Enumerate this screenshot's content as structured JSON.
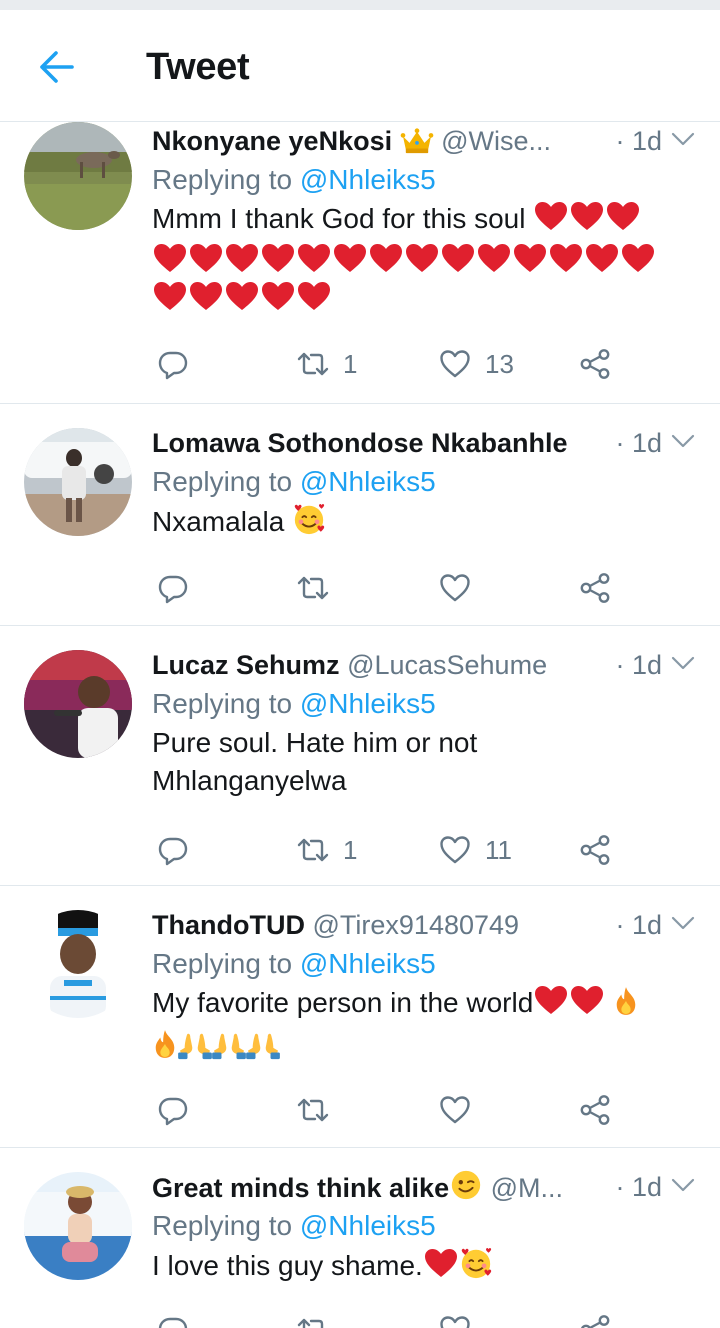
{
  "header": {
    "title": "Tweet"
  },
  "colors": {
    "accent": "#1da1f2",
    "heart": "#e0202e",
    "muted": "#657786"
  },
  "tweets": [
    {
      "name": "Nkonyane yeNkosi",
      "handle": "@Wise...",
      "time": "· 1d",
      "replying_prefix": "Replying to ",
      "replying_handle": "@Nhleiks5",
      "text": "Mmm I thank God for this soul",
      "retweets": "1",
      "likes": "13"
    },
    {
      "name": "Lomawa Sothondose Nkabanhle",
      "handle": "",
      "time": "· 1d",
      "replying_prefix": "Replying to ",
      "replying_handle": "@Nhleiks5",
      "text": "Nxamalala",
      "retweets": "",
      "likes": ""
    },
    {
      "name": "Lucaz Sehumz",
      "handle": "@LucasSehume",
      "time": "· 1d",
      "replying_prefix": "Replying to ",
      "replying_handle": "@Nhleiks5",
      "text_line1": "Pure soul. Hate him or not",
      "text_line2": "Mhlanganyelwa",
      "retweets": "1",
      "likes": "11"
    },
    {
      "name": "ThandoTUD",
      "handle": "@Tirex91480749",
      "time": "· 1d",
      "replying_prefix": "Replying to ",
      "replying_handle": "@Nhleiks5",
      "text": "My favorite person in the world",
      "retweets": "",
      "likes": ""
    },
    {
      "name": "Great minds think alike",
      "handle": "@M...",
      "time": "· 1d",
      "replying_prefix": "Replying to ",
      "replying_handle": "@Nhleiks5",
      "text": "I love this guy shame.",
      "retweets": "",
      "likes": ""
    }
  ]
}
